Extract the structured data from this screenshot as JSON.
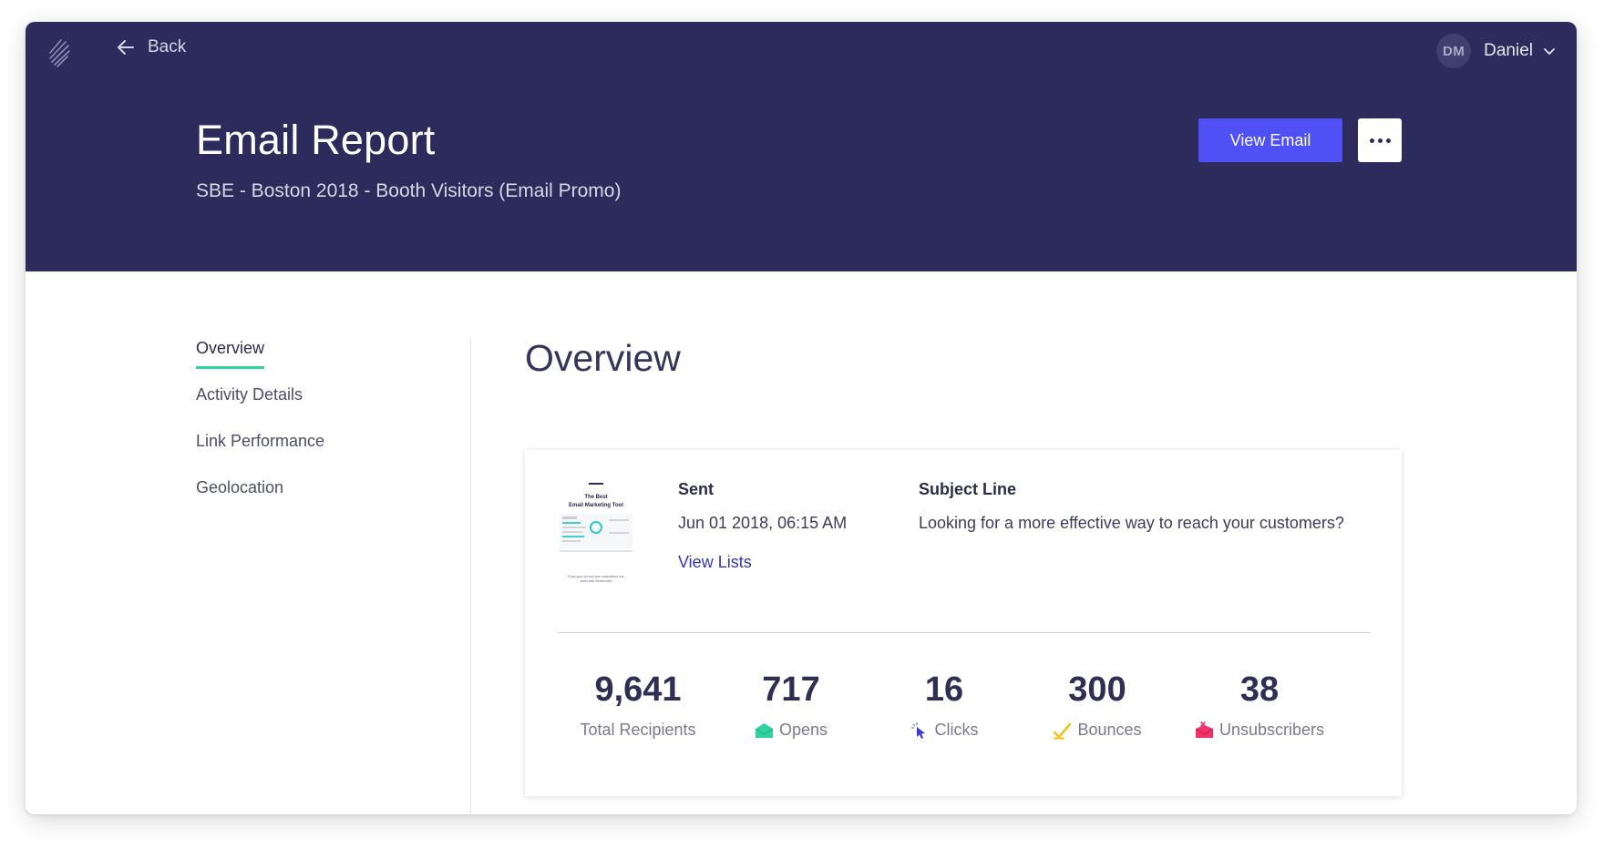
{
  "header": {
    "back_label": "Back",
    "user_initials": "DM",
    "user_name": "Daniel",
    "title": "Email Report",
    "subtitle": "SBE - Boston 2018 - Booth Visitors (Email Promo)",
    "view_email_label": "View Email",
    "accent_color": "#4f50f5",
    "background_color": "#2c2b5c"
  },
  "sidenav": {
    "items": [
      {
        "label": "Overview",
        "active": true
      },
      {
        "label": "Activity Details",
        "active": false
      },
      {
        "label": "Link Performance",
        "active": false
      },
      {
        "label": "Geolocation",
        "active": false
      }
    ],
    "active_indicator_color": "#2fd3a0"
  },
  "main": {
    "section_title": "Overview",
    "summary": {
      "thumbnail": {
        "heading_line1": "The Best",
        "heading_line2": "Email Marketing Tool",
        "footer_line1": "Grow your list and turn subscribers into",
        "footer_line2": "sales with Benchmark"
      },
      "sent_label": "Sent",
      "sent_value": "Jun 01 2018, 06:15 AM",
      "view_lists_label": "View Lists",
      "subject_label": "Subject Line",
      "subject_value": "Looking for a more effective way to reach your customers?"
    },
    "stats": [
      {
        "value": "9,641",
        "label": "Total Recipients",
        "icon": "none"
      },
      {
        "value": "717",
        "label": "Opens",
        "icon": "open-envelope-icon"
      },
      {
        "value": "16",
        "label": "Clicks",
        "icon": "cursor-click-icon"
      },
      {
        "value": "300",
        "label": "Bounces",
        "icon": "bounce-check-icon"
      },
      {
        "value": "38",
        "label": "Unsubscribers",
        "icon": "unsubscribe-envelope-icon"
      }
    ]
  }
}
